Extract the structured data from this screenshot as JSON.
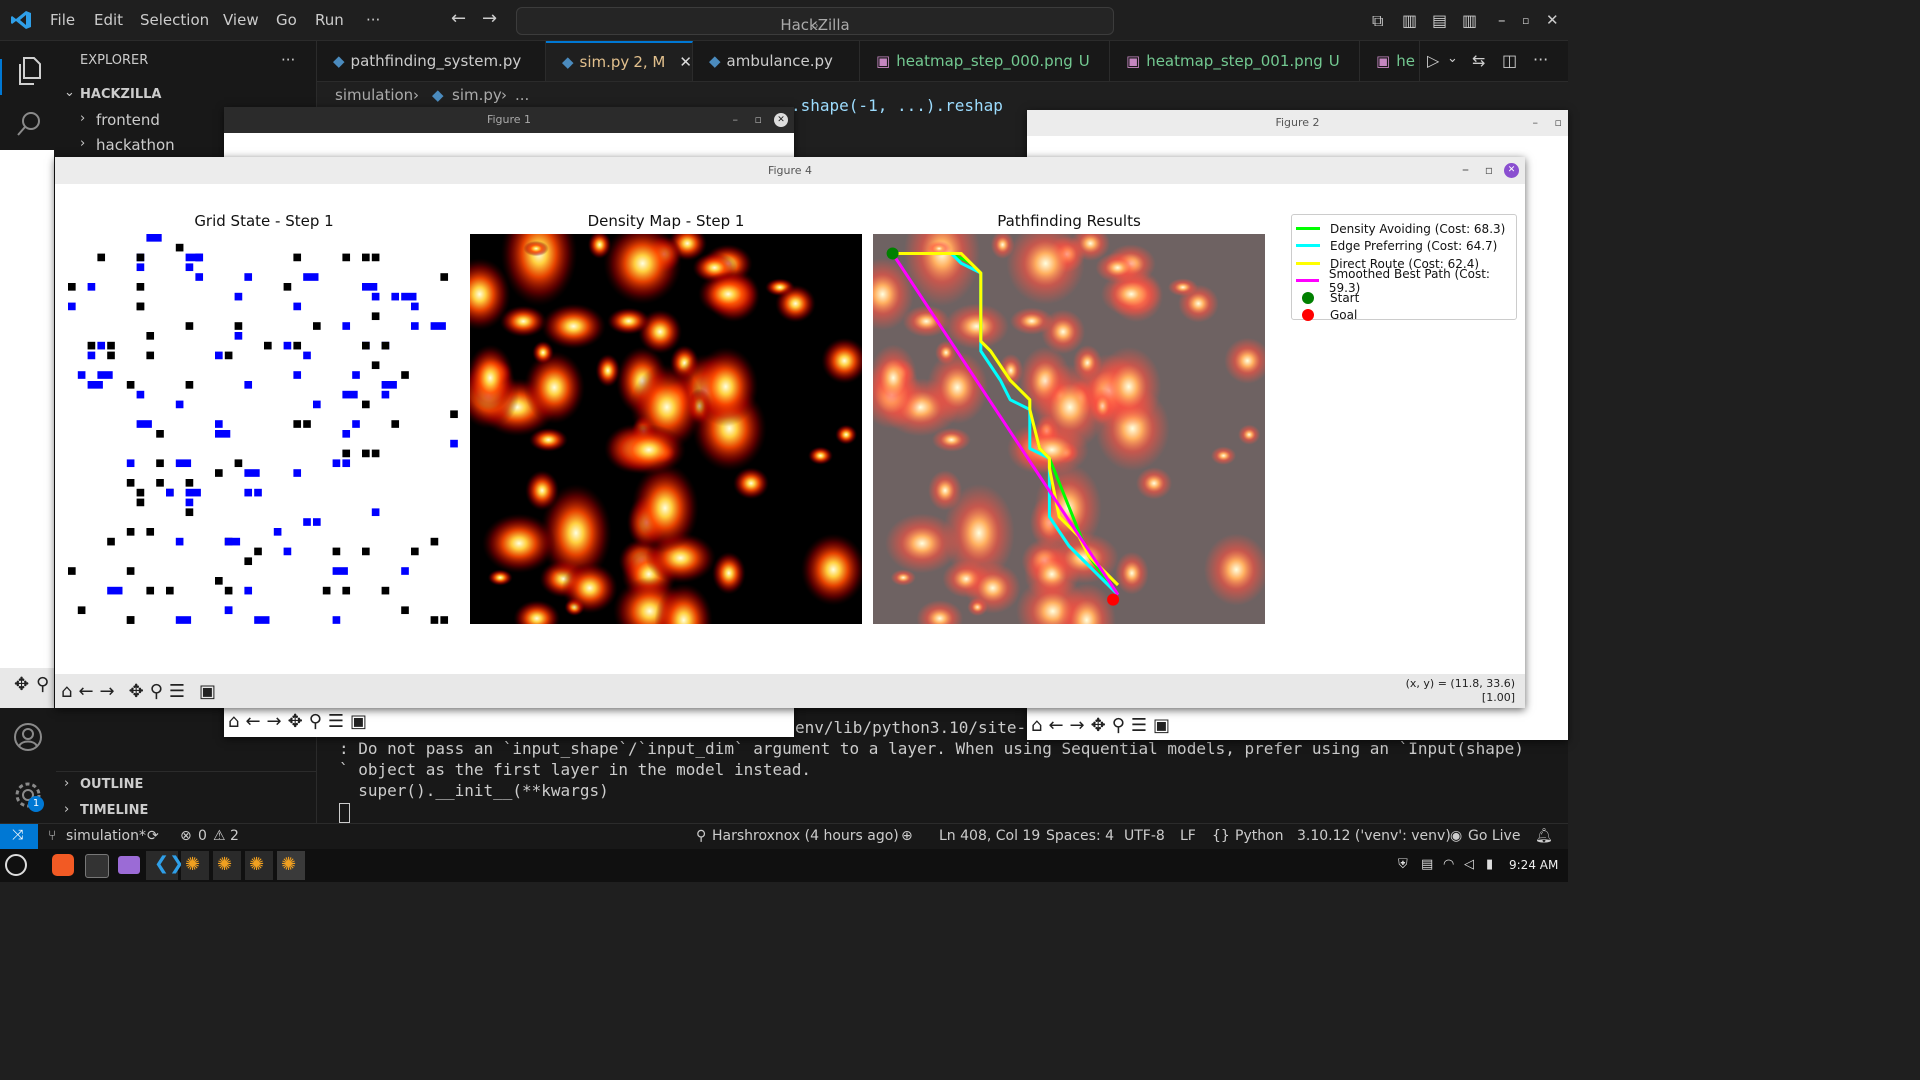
{
  "titlebar": {
    "menu": [
      "File",
      "Edit",
      "Selection",
      "View",
      "Go",
      "Run"
    ],
    "more": "···",
    "search_text": "HackZilla"
  },
  "sidebar": {
    "title": "EXPLORER",
    "more": "···",
    "workspace": "HACKZILLA",
    "folders": [
      "frontend",
      "hackathon"
    ],
    "outline": "OUTLINE",
    "timeline": "TIMELINE",
    "settings_badge": "1"
  },
  "tabs": [
    {
      "label": "pathfinding_system.py",
      "suffix": "",
      "active": false
    },
    {
      "label": "sim.py",
      "suffix": "2, M",
      "active": true
    },
    {
      "label": "ambulance.py",
      "suffix": "",
      "active": false
    },
    {
      "label": "heatmap_step_000.png",
      "suffix": "U",
      "active": false
    },
    {
      "label": "heatmap_step_001.png",
      "suffix": "U",
      "active": false
    },
    {
      "label": "he",
      "suffix": "",
      "active": false
    }
  ],
  "breadcrumb": [
    "simulation",
    "sim.py",
    "..."
  ],
  "editor_snippet": ".shape(-1, ...).reshap",
  "figures": {
    "figure1_title": "Figure 1",
    "figure2_title": "Figure 2",
    "figure4_title": "Figure 4",
    "coords_readout": "(x, y) = (11.8, 33.6)",
    "zoom_readout": "[1.00]"
  },
  "plots": {
    "grid_title": "Grid State - Step 1",
    "density_title": "Density Map - Step 1",
    "path_title": "Pathfinding Results"
  },
  "chart_data": {
    "type": "line",
    "title": "Pathfinding Results",
    "xlabel": "",
    "ylabel": "",
    "xlim": [
      0,
      40
    ],
    "ylim": [
      40,
      0
    ],
    "series": [
      {
        "name": "Density Avoiding (Cost: 68.3)",
        "color": "#00ff00",
        "x": [
          2,
          5,
          8,
          10,
          11,
          11,
          12,
          14,
          16,
          16,
          17,
          18,
          18,
          20,
          22,
          25
        ],
        "y": [
          2,
          2,
          2,
          3,
          4,
          11,
          12,
          15,
          17,
          18,
          22,
          23,
          23,
          28,
          33,
          37
        ]
      },
      {
        "name": "Edge Preferring (Cost: 64.7)",
        "color": "#00ffff",
        "x": [
          2,
          8,
          9,
          11,
          11,
          13,
          14,
          16,
          16,
          18,
          18,
          18,
          20,
          24,
          25
        ],
        "y": [
          2,
          2,
          3,
          4,
          12,
          15,
          17,
          18,
          22,
          23,
          24,
          29,
          32,
          36,
          37
        ]
      },
      {
        "name": "Direct Route (Cost: 62.4)",
        "color": "#ffff00",
        "x": [
          2,
          7,
          9,
          11,
          11,
          12,
          14,
          16,
          16,
          17,
          18,
          18,
          19,
          21,
          22,
          25
        ],
        "y": [
          2,
          2,
          2,
          4,
          11,
          12,
          15,
          17,
          18,
          22,
          23,
          24,
          29,
          31,
          33,
          36
        ]
      },
      {
        "name": "Smoothed Best Path (Cost: 59.3)",
        "color": "#ff00ff",
        "x": [
          2,
          25
        ],
        "y": [
          2,
          37
        ]
      },
      {
        "name": "Start",
        "color": "#008000",
        "x": [
          2
        ],
        "y": [
          2
        ],
        "marker": "point"
      },
      {
        "name": "Goal",
        "color": "#ff0000",
        "x": [
          24.5
        ],
        "y": [
          37.5
        ],
        "marker": "point"
      }
    ],
    "legend_position": "right"
  },
  "terminal": {
    "line0_right": "env/lib/python3.10/site-",
    "line1": ": Do not pass an `input_shape`/`input_dim` argument to a layer. When using Sequential models, prefer using an `Input(shape)",
    "line2": "` object as the first layer in the model instead.",
    "line3": "  super().__init__(**kwargs)"
  },
  "statusbar": {
    "branch": "simulation*",
    "errors": "0",
    "warnings": "2",
    "blame": "Harshroxnox (4 hours ago)",
    "position": "Ln 408, Col 19",
    "spaces": "Spaces: 4",
    "encoding": "UTF-8",
    "eol": "LF",
    "language": "Python",
    "interpreter": "3.10.12 ('venv': venv)",
    "golive": "Go Live"
  },
  "taskbar": {
    "time": "9:24 AM"
  }
}
